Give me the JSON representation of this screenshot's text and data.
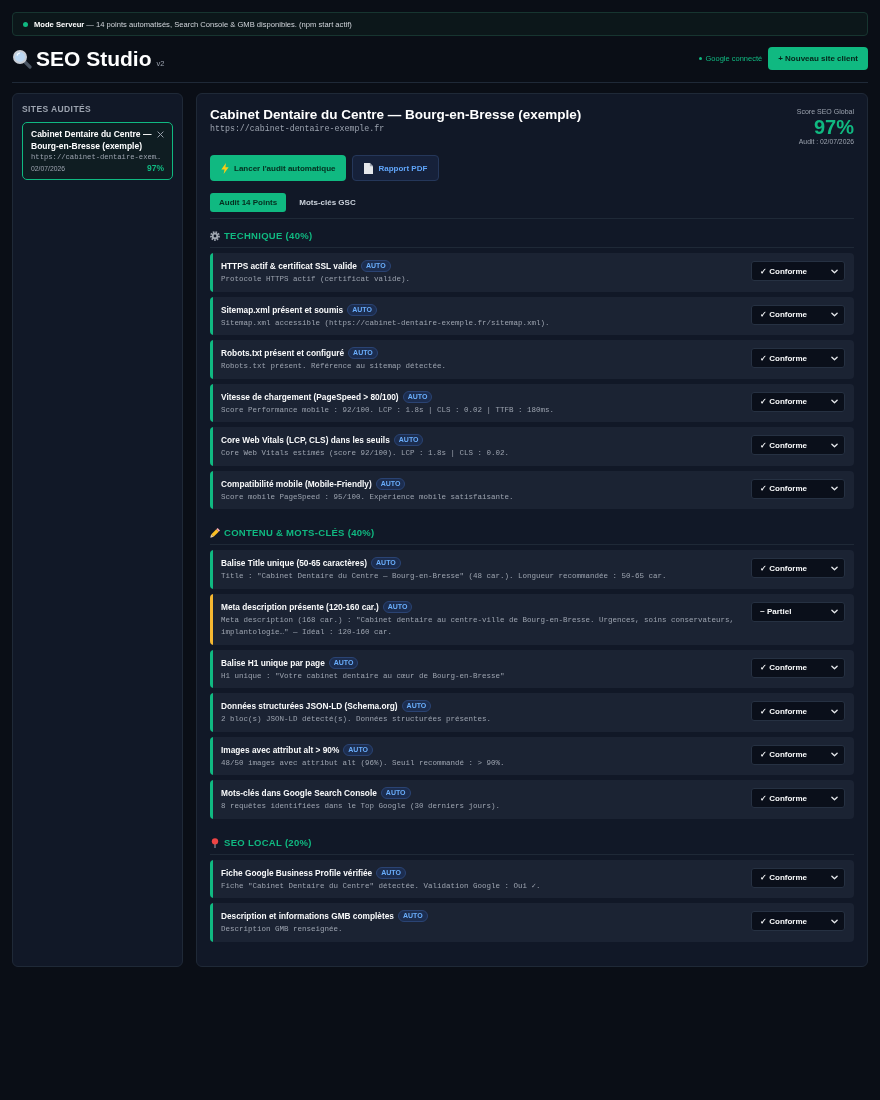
{
  "banner": {
    "message": "**Mode Serveur** — 14 points automatisés, Search Console & GMB disponibles. (npm start actif)"
  },
  "header": {
    "title": "SEO Studio",
    "version": "v2",
    "connection": "Google connecté",
    "new_button": "+ Nouveau site client"
  },
  "sidebar": {
    "heading": "SITES AUDITÉS",
    "sites": [
      {
        "name": "Cabinet Dentaire du Centre — Bourg-en-Bresse (exemple)",
        "url": "https://cabinet-dentaire-exem…",
        "date": "02/07/2026",
        "score": "97%",
        "selected": true
      }
    ]
  },
  "main": {
    "title": "Cabinet Dentaire du Centre — Bourg-en-Bresse (exemple)",
    "url": "https://cabinet-dentaire-exemple.fr",
    "score": {
      "label": "Score SEO Global",
      "value": "97%",
      "audit_date": "Audit : 02/07/2026"
    },
    "actions": [
      {
        "kind": "primary",
        "label": "Lancer l'audit automatique"
      },
      {
        "kind": "secondary",
        "label": "Rapport PDF"
      }
    ],
    "tabs": [
      {
        "label": "Audit 14 Points",
        "selected": true
      },
      {
        "label": "Mots-clés GSC",
        "selected": false
      }
    ],
    "sections": [
      {
        "title": "TECHNIQUE (40%)",
        "checks": [
          {
            "title": "HTTPS actif & certificat SSL valide",
            "badge": "AUTO",
            "detail": "Protocole HTTPS actif (certificat valide).",
            "status": "✓ Conforme",
            "color": "#10b981"
          },
          {
            "title": "Sitemap.xml présent et soumis",
            "badge": "AUTO",
            "detail": "Sitemap.xml accessible (https://cabinet-dentaire-exemple.fr/sitemap.xml).",
            "status": "✓ Conforme",
            "color": "#10b981"
          },
          {
            "title": "Robots.txt présent et configuré",
            "badge": "AUTO",
            "detail": "Robots.txt présent. Référence au sitemap détectée.",
            "status": "✓ Conforme",
            "color": "#10b981"
          },
          {
            "title": "Vitesse de chargement (PageSpeed > 80/100)",
            "badge": "AUTO",
            "detail": "Score Performance mobile : 92/100. LCP : 1.8s | CLS : 0.02 | TTFB : 180ms.",
            "status": "✓ Conforme",
            "color": "#10b981"
          },
          {
            "title": "Core Web Vitals (LCP, CLS) dans les seuils",
            "badge": "AUTO",
            "detail": "Core Web Vitals estimés (score 92/100). LCP : 1.8s | CLS : 0.02.",
            "status": "✓ Conforme",
            "color": "#10b981"
          },
          {
            "title": "Compatibilité mobile (Mobile-Friendly)",
            "badge": "AUTO",
            "detail": "Score mobile PageSpeed : 95/100. Expérience mobile satisfaisante.",
            "status": "✓ Conforme",
            "color": "#10b981"
          }
        ]
      },
      {
        "title": "CONTENU & MOTS-CLÉS (40%)",
        "checks": [
          {
            "title": "Balise Title unique (50-65 caractères)",
            "badge": "AUTO",
            "detail": "Title : \"Cabinet Dentaire du Centre — Bourg-en-Bresse\" (48 car.). Longueur recommandée : 50-65 car.",
            "status": "✓ Conforme",
            "color": "#10b981"
          },
          {
            "title": "Meta description présente (120-160 car.)",
            "badge": "AUTO",
            "detail": "Meta description (168 car.) : \"Cabinet dentaire au centre-ville de Bourg-en-Bresse. Urgences, soins conservateurs, implantologie…\" — Idéal : 120-160 car.",
            "status": "~ Partiel",
            "color": "#f5b731"
          },
          {
            "title": "Balise H1 unique par page",
            "badge": "AUTO",
            "detail": "H1 unique : \"Votre cabinet dentaire au cœur de Bourg-en-Bresse\"",
            "status": "✓ Conforme",
            "color": "#10b981"
          },
          {
            "title": "Données structurées JSON-LD (Schema.org)",
            "badge": "AUTO",
            "detail": "2 bloc(s) JSON-LD détecté(s). Données structurées présentes.",
            "status": "✓ Conforme",
            "color": "#10b981"
          },
          {
            "title": "Images avec attribut alt > 90%",
            "badge": "AUTO",
            "detail": "48/50 images avec attribut alt (96%). Seuil recommandé : > 90%.",
            "status": "✓ Conforme",
            "color": "#10b981"
          },
          {
            "title": "Mots-clés dans Google Search Console",
            "badge": "AUTO",
            "detail": "8 requêtes identifiées dans le Top Google (30 derniers jours).",
            "status": "✓ Conforme",
            "color": "#10b981"
          }
        ]
      },
      {
        "title": "SEO LOCAL (20%)",
        "checks": [
          {
            "title": "Fiche Google Business Profile vérifiée",
            "badge": "AUTO",
            "detail": "Fiche \"Cabinet Dentaire du Centre\" détectée. Validation Google : Oui ✓.",
            "status": "✓ Conforme",
            "color": "#10b981"
          },
          {
            "title": "Description et informations GMB complètes",
            "badge": "AUTO",
            "detail": "Description GMB renseignée.",
            "status": "✓ Conforme",
            "color": "#10b981"
          }
        ]
      }
    ]
  }
}
